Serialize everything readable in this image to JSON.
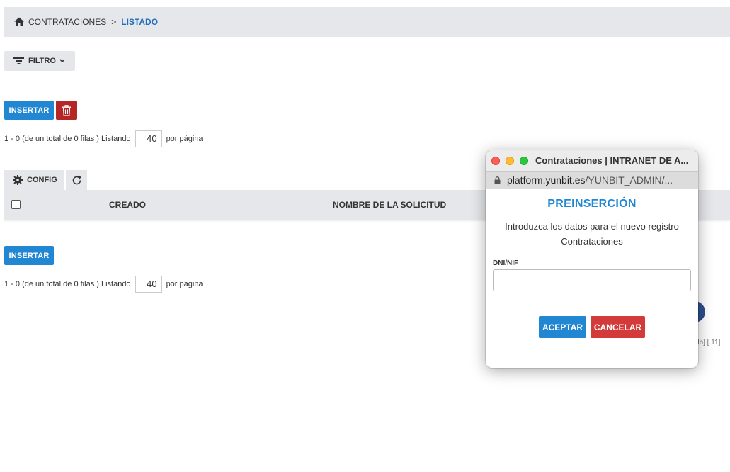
{
  "breadcrumb": {
    "home_icon": "home-icon",
    "parent": "CONTRATACIONES",
    "separator": ">",
    "current": "LISTADO"
  },
  "filter": {
    "label": "FILTRO",
    "icon": "filter-lines-icon"
  },
  "toolbar": {
    "insert_label": "INSERTAR",
    "delete_icon": "trash-icon"
  },
  "pagination_top": {
    "summary": "1 - 0 (de un total de 0 filas ) Listando",
    "per_page": "40",
    "suffix": "por página"
  },
  "table": {
    "config_label": "CONFIG",
    "refresh_icon": "refresh-icon",
    "columns": [
      "CREADO",
      "NOMBRE DE LA SOLICITUD"
    ]
  },
  "bottom": {
    "insert_label": "INSERTAR",
    "summary": "1 - 0 (de un total de 0 filas ) Listando",
    "per_page": "40",
    "suffix": "por página"
  },
  "background_partial": {
    "version_text": "db] [.11]"
  },
  "popup": {
    "window_title": "Contrataciones | INTRANET DE A...",
    "url_host": "platform.yunbit.es",
    "url_path": "/YUNBIT_ADMIN/...",
    "heading": "PREINSERCIÓN",
    "description": "Introduzca los datos para el nuevo registro Contrataciones",
    "field_label": "DNI/NIF",
    "field_value": "",
    "accept_label": "ACEPTAR",
    "cancel_label": "CANCELAR"
  },
  "colors": {
    "primary": "#2187d3",
    "danger": "#b52626",
    "cancel": "#d33a3a",
    "header_bg": "#e6e7ea",
    "breadcrumb_active": "#1f6fbf"
  }
}
